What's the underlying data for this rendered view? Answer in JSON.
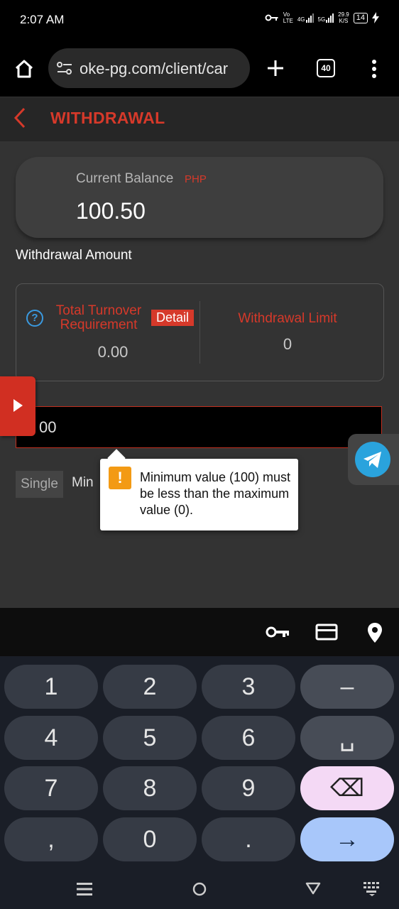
{
  "status_bar": {
    "time": "2:07 AM",
    "net_vo": "Vo",
    "net_lte": "LTE",
    "net_4g": "4G",
    "net_5g": "5G",
    "speed_value": "29.9",
    "speed_unit": "K/S",
    "battery": "14"
  },
  "browser": {
    "url": "oke-pg.com/client/car",
    "tab_count": "40"
  },
  "header": {
    "title": "WITHDRAWAL"
  },
  "balance": {
    "label": "Current Balance",
    "currency": "PHP",
    "amount": "100.50"
  },
  "withdrawal": {
    "amount_label": "Withdrawal Amount",
    "turnover_label": "Total Turnover Requirement",
    "detail_label": "Detail",
    "turnover_value": "0.00",
    "limit_label": "Withdrawal Limit",
    "limit_value": "0",
    "amount_value": "00",
    "single_label": "Single",
    "min_label": "Min"
  },
  "tooltip": {
    "message": "Minimum value (100) must be less than the maximum value (0)."
  },
  "keyboard": {
    "keys": [
      "1",
      "2",
      "3",
      "–",
      "4",
      "5",
      "6",
      "␣",
      "7",
      "8",
      "9",
      "⌫",
      ",",
      "0",
      ".",
      "→"
    ]
  },
  "colors": {
    "accent": "#d6392a",
    "telegram": "#2aa3dd",
    "warning": "#f39a14",
    "enter_key": "#a8c7fa",
    "delete_key": "#f4d9f5"
  }
}
